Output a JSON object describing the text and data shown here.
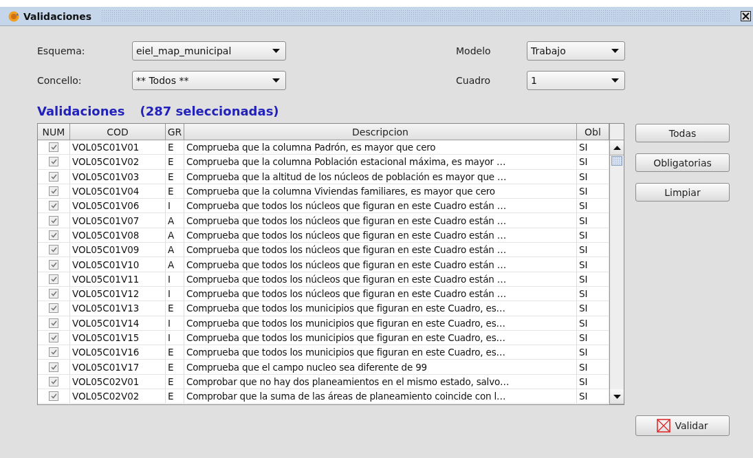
{
  "window": {
    "title": "Validaciones"
  },
  "filters": [
    {
      "label": "Esquema:",
      "value": "eiel_map_municipal"
    },
    {
      "label": "Modelo",
      "value": "Trabajo"
    },
    {
      "label": "Concello:",
      "value": "** Todos **"
    },
    {
      "label": "Cuadro",
      "value": "1"
    }
  ],
  "heading": {
    "title": "Validaciones",
    "count": "(287 seleccionadas)"
  },
  "table": {
    "columns": [
      "NUM",
      "COD",
      "GR",
      "Descripcion",
      "Obl"
    ],
    "rows": [
      {
        "checked": true,
        "cod": "VOL05C01V01",
        "gr": "E",
        "descripcion": "Comprueba que la columna Padrón, es mayor que cero",
        "obl": "SI"
      },
      {
        "checked": true,
        "cod": "VOL05C01V02",
        "gr": "E",
        "descripcion": "Comprueba que la columna Población estacional máxima, es mayor …",
        "obl": "SI"
      },
      {
        "checked": true,
        "cod": "VOL05C01V03",
        "gr": "E",
        "descripcion": "Comprueba que la altitud de los núcleos de población es mayor que …",
        "obl": "SI"
      },
      {
        "checked": true,
        "cod": "VOL05C01V04",
        "gr": "E",
        "descripcion": "Comprueba que la columna Viviendas familiares, es mayor que cero",
        "obl": "SI"
      },
      {
        "checked": true,
        "cod": "VOL05C01V06",
        "gr": "I",
        "descripcion": "Comprueba que todos los núcleos que figuran en este Cuadro están …",
        "obl": "SI"
      },
      {
        "checked": true,
        "cod": "VOL05C01V07",
        "gr": "A",
        "descripcion": "Comprueba que todos los núcleos que figuran en este Cuadro están …",
        "obl": "SI"
      },
      {
        "checked": true,
        "cod": "VOL05C01V08",
        "gr": "A",
        "descripcion": "Comprueba que todos los núcleos que figuran en este Cuadro están …",
        "obl": "SI"
      },
      {
        "checked": true,
        "cod": "VOL05C01V09",
        "gr": "A",
        "descripcion": "Comprueba que todos los núcleos que figuran en este Cuadro están …",
        "obl": "SI"
      },
      {
        "checked": true,
        "cod": "VOL05C01V10",
        "gr": "A",
        "descripcion": "Comprueba que todos los núcleos que figuran en este Cuadro están …",
        "obl": "SI"
      },
      {
        "checked": true,
        "cod": "VOL05C01V11",
        "gr": "I",
        "descripcion": "Comprueba que todos los núcleos que figuran en este Cuadro están …",
        "obl": "SI"
      },
      {
        "checked": true,
        "cod": "VOL05C01V12",
        "gr": "I",
        "descripcion": "Comprueba que todos los núcleos que figuran en este Cuadro están …",
        "obl": "SI"
      },
      {
        "checked": true,
        "cod": "VOL05C01V13",
        "gr": "E",
        "descripcion": "Comprueba que todos los municipios que figuran en este Cuadro, es…",
        "obl": "SI"
      },
      {
        "checked": true,
        "cod": "VOL05C01V14",
        "gr": "I",
        "descripcion": "Comprueba que todos los municipios que figuran en este Cuadro, es…",
        "obl": "SI"
      },
      {
        "checked": true,
        "cod": "VOL05C01V15",
        "gr": "I",
        "descripcion": "Comprueba que todos los municipios que figuran en este Cuadro, es…",
        "obl": "SI"
      },
      {
        "checked": true,
        "cod": "VOL05C01V16",
        "gr": "E",
        "descripcion": "Comprueba que todos los municipios que figuran en este Cuadro, es…",
        "obl": "SI"
      },
      {
        "checked": true,
        "cod": "VOL05C01V17",
        "gr": "E",
        "descripcion": "Comprueba que el campo nucleo sea diferente de 99",
        "obl": "SI"
      },
      {
        "checked": true,
        "cod": "VOL05C02V01",
        "gr": "E",
        "descripcion": "Comprobar que no hay dos planeamientos en el mismo estado, salvo…",
        "obl": "SI"
      },
      {
        "checked": true,
        "cod": "VOL05C02V02",
        "gr": "E",
        "descripcion": "Comprobar que la suma de las áreas de planeamiento coincide con l…",
        "obl": "SI"
      }
    ]
  },
  "side_buttons": [
    "Todas",
    "Obligatorias",
    "Limpiar"
  ],
  "validate_button": "Validar"
}
